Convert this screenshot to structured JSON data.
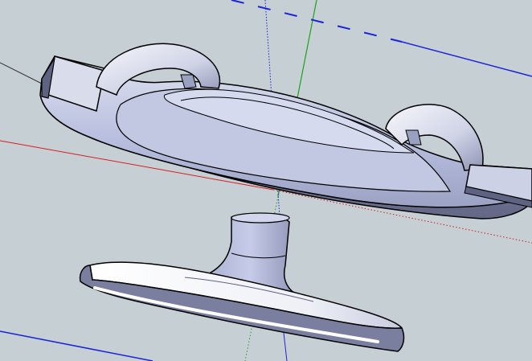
{
  "viewport": {
    "background": "#c6cfd4",
    "axis_colors": {
      "red": "#d42020",
      "green": "#19a319",
      "blue": "#1b23d8",
      "dark": "#333333"
    },
    "model_colors": {
      "face_light": "#f2f4f8",
      "face_mid": "#b8bfdc",
      "face_dark": "#6e7292",
      "edge": "#000000"
    }
  }
}
